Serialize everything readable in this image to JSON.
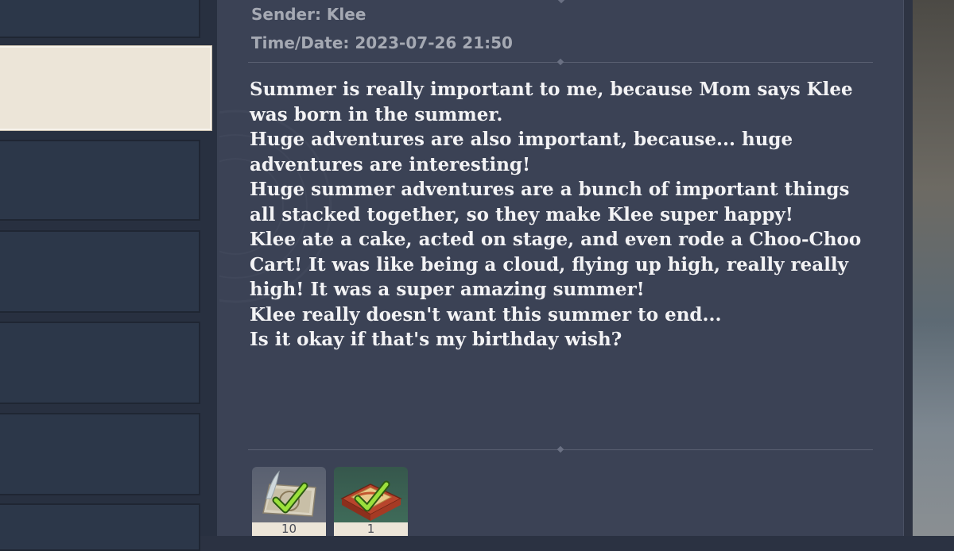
{
  "mail": {
    "sender": "Sender: Klee",
    "datetime": "Time/Date: 2023-07-26 21:50",
    "body_lines": [
      "Summer is really important to me, because Mom says Klee",
      "was born in the summer.",
      "Huge adventures are also important, because... huge",
      "adventures are interesting!",
      "Huge summer adventures are a bunch of important things",
      "all stacked together, so they make Klee super happy!",
      "Klee ate a cake, acted on stage, and even rode a Choo-Choo",
      "Cart! It was like being a cloud, flying up high, really really",
      "high! It was a super amazing summer!",
      "Klee really doesn't want this summer to end...",
      "Is it okay if that's my birthday wish?"
    ]
  },
  "attachments": [
    {
      "icon": "map-with-feather-icon",
      "count": "10",
      "claimed": true,
      "rarity_color": "#6b6f7b"
    },
    {
      "icon": "cake-gift-box-icon",
      "count": "1",
      "claimed": true,
      "rarity_color": "#3f6b59"
    }
  ],
  "colors": {
    "panel_background": "#3b4255",
    "selected_item": "#ece5d8",
    "body_text": "#f2f2f4",
    "meta_text": "#a5a9b3",
    "claimed_check": "#9be03c"
  }
}
